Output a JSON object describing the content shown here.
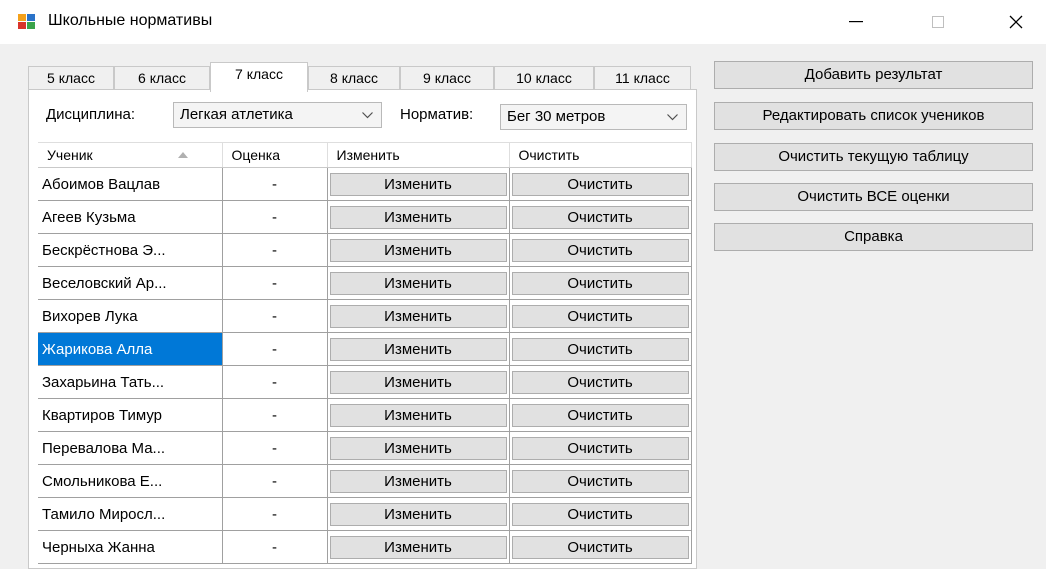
{
  "window": {
    "title": "Школьные нормативы"
  },
  "tabs": [
    "5 класс",
    "6 класс",
    "7 класс",
    "8 класс",
    "9 класс",
    "10 класс",
    "11 класс"
  ],
  "active_tab": "7 класс",
  "filters": {
    "discipline_label": "Дисциплина:",
    "discipline_value": "Легкая атлетика",
    "norm_label": "Норматив:",
    "norm_value": "Бег 30 метров"
  },
  "grid": {
    "columns": [
      "Ученик",
      "Оценка",
      "Изменить",
      "Очистить"
    ],
    "edit_label": "Изменить",
    "clear_label": "Очистить",
    "rows": [
      {
        "name": "Абоимов Вацлав",
        "grade": "-"
      },
      {
        "name": "Агеев Кузьма",
        "grade": "-"
      },
      {
        "name": "Бескрёстнова Э...",
        "grade": "-"
      },
      {
        "name": "Веселовский Ар...",
        "grade": "-"
      },
      {
        "name": "Вихорев Лука",
        "grade": "-"
      },
      {
        "name": "Жарикова Алла",
        "grade": "-"
      },
      {
        "name": "Захарьина Тать...",
        "grade": "-"
      },
      {
        "name": "Квартиров Тимур",
        "grade": "-"
      },
      {
        "name": "Перевалова Ма...",
        "grade": "-"
      },
      {
        "name": "Смольникова Е...",
        "grade": "-"
      },
      {
        "name": "Тамило Миросл...",
        "grade": "-"
      },
      {
        "name": "Черныха Жанна",
        "grade": "-"
      }
    ],
    "selected_name": "Жарикова Алла"
  },
  "actions": [
    "Добавить результат",
    "Редактировать список учеников",
    "Очистить текущую таблицу",
    "Очистить ВСЕ оценки",
    "Справка"
  ],
  "colors": {
    "selection": "#0078d7",
    "button_face": "#e1e1e1"
  }
}
